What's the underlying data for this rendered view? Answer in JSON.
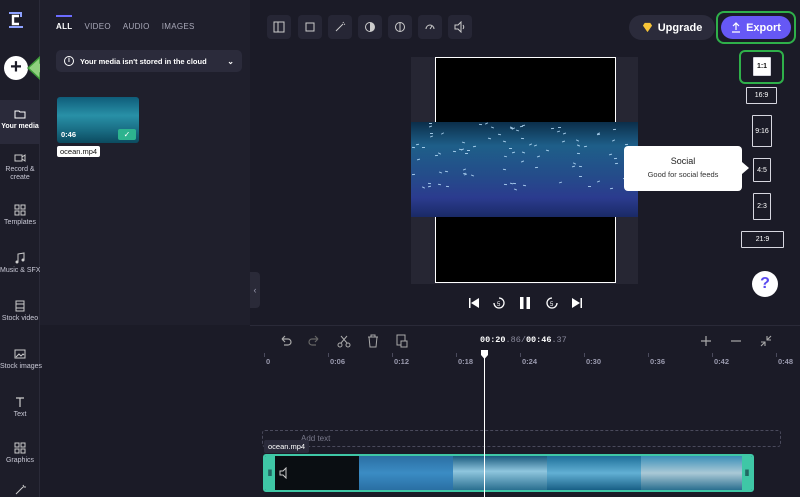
{
  "rail": {
    "items": [
      {
        "label": "Your media"
      },
      {
        "label": "Record &\ncreate"
      },
      {
        "label": "Templates"
      },
      {
        "label": "Music & SFX"
      },
      {
        "label": "Stock video"
      },
      {
        "label": "Stock images"
      },
      {
        "label": "Text"
      },
      {
        "label": "Graphics"
      }
    ]
  },
  "media": {
    "tabs": [
      "ALL",
      "VIDEO",
      "AUDIO",
      "IMAGES"
    ],
    "notice": "Your media isn't stored in the cloud",
    "asset": {
      "duration": "0:46",
      "name": "ocean.mp4"
    }
  },
  "header": {
    "upgrade_label": "Upgrade",
    "export_label": "Export"
  },
  "aspect_ratios": [
    "1:1",
    "16:9",
    "9:16",
    "4:5",
    "2:3",
    "21:9"
  ],
  "selected_ratio": "1:1",
  "tooltip": {
    "title": "Social",
    "subtitle": "Good for social feeds"
  },
  "help_label": "?",
  "timeline": {
    "current": "00:20",
    "current_frac": ".86",
    "separator": "/",
    "total": "00:46",
    "total_frac": ".37",
    "ticks": [
      "0",
      "0:06",
      "0:12",
      "0:18",
      "0:24",
      "0:30",
      "0:36",
      "0:42",
      "0:48"
    ],
    "text_track_placeholder": "Add text",
    "clip_name": "ocean.mp4"
  },
  "colors": {
    "accent": "#6658f5",
    "highlight": "#2fb04a",
    "clip_border": "#3fc7a6"
  }
}
